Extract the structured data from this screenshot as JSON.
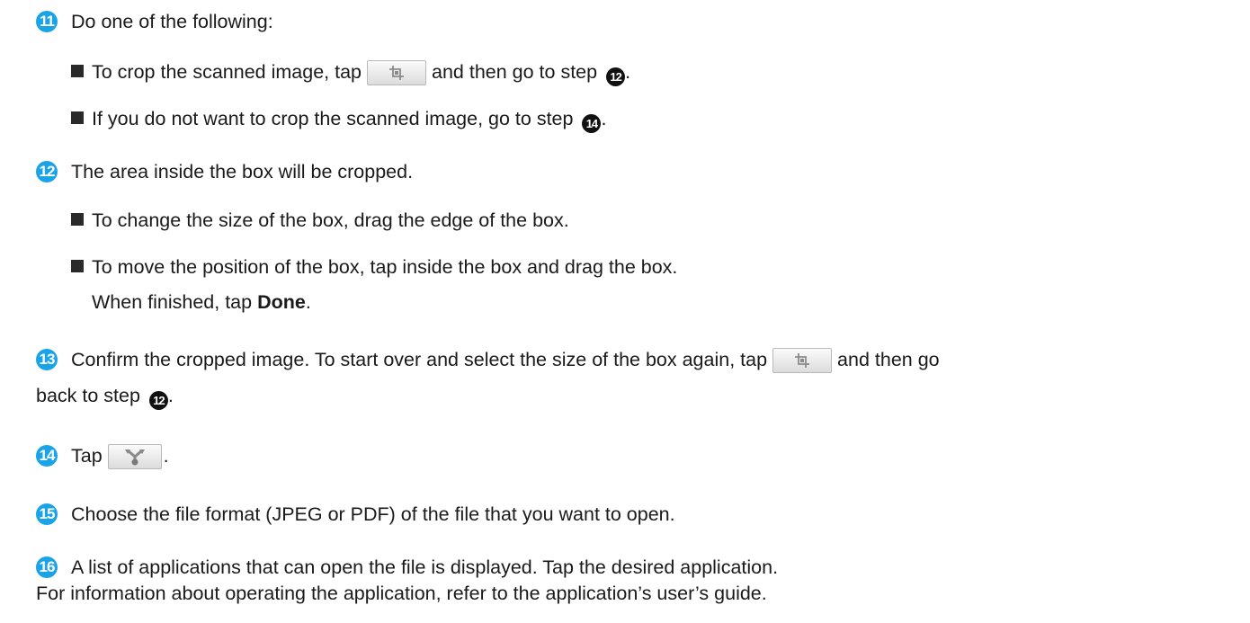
{
  "steps": [
    {
      "number": "11",
      "text": "Do one of the following:"
    },
    {
      "number": "12",
      "text": "The area inside the box will be cropped."
    },
    {
      "number": "13",
      "text_a": "Confirm the cropped image. To start over and select the size of the box again, tap",
      "text_b": "and then go",
      "text_c": "back to step",
      "ref": "12"
    },
    {
      "number": "14",
      "text": "Tap"
    },
    {
      "number": "15",
      "text": "Choose the file format (JPEG or PDF) of the file that you want to open."
    },
    {
      "number": "16",
      "text_a": "A list of applications that can open the file is displayed. Tap the desired application.",
      "text_b": "For information about operating the application, refer to the application’s user’s guide."
    }
  ],
  "step11_bullets": [
    {
      "text_a": "To crop the scanned image, tap",
      "text_b": "and then go to step",
      "ref": "12"
    },
    {
      "text_a": "If you do not want to crop the scanned image, go to step",
      "ref": "14"
    }
  ],
  "step12_bullets": [
    {
      "text": "To change the size of the box, drag the edge of the box."
    },
    {
      "text": "To move the position of the box, tap inside the box and drag the box."
    }
  ],
  "step12_finish": {
    "prefix": "When finished, tap",
    "bold": "Done"
  },
  "period": ".",
  "icons": {
    "crop": "crop-icon",
    "share": "share-icon"
  },
  "colors": {
    "step_number": "#1aa3e6",
    "text": "#1a1a1a"
  }
}
